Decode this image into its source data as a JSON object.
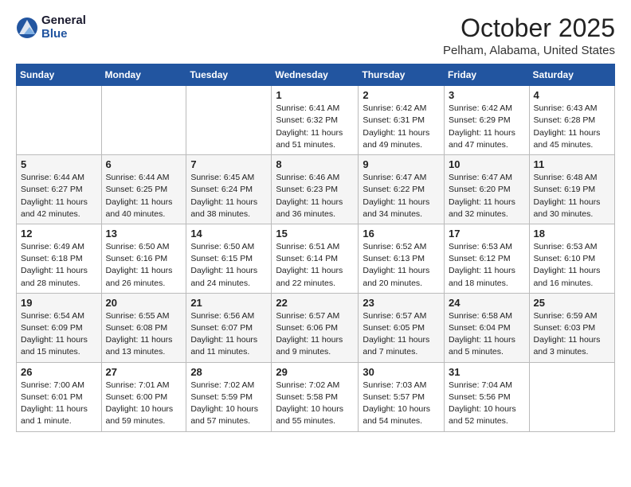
{
  "logo": {
    "general": "General",
    "blue": "Blue"
  },
  "header": {
    "month": "October 2025",
    "location": "Pelham, Alabama, United States"
  },
  "weekdays": [
    "Sunday",
    "Monday",
    "Tuesday",
    "Wednesday",
    "Thursday",
    "Friday",
    "Saturday"
  ],
  "weeks": [
    [
      {
        "day": "",
        "info": ""
      },
      {
        "day": "",
        "info": ""
      },
      {
        "day": "",
        "info": ""
      },
      {
        "day": "1",
        "info": "Sunrise: 6:41 AM\nSunset: 6:32 PM\nDaylight: 11 hours\nand 51 minutes."
      },
      {
        "day": "2",
        "info": "Sunrise: 6:42 AM\nSunset: 6:31 PM\nDaylight: 11 hours\nand 49 minutes."
      },
      {
        "day": "3",
        "info": "Sunrise: 6:42 AM\nSunset: 6:29 PM\nDaylight: 11 hours\nand 47 minutes."
      },
      {
        "day": "4",
        "info": "Sunrise: 6:43 AM\nSunset: 6:28 PM\nDaylight: 11 hours\nand 45 minutes."
      }
    ],
    [
      {
        "day": "5",
        "info": "Sunrise: 6:44 AM\nSunset: 6:27 PM\nDaylight: 11 hours\nand 42 minutes."
      },
      {
        "day": "6",
        "info": "Sunrise: 6:44 AM\nSunset: 6:25 PM\nDaylight: 11 hours\nand 40 minutes."
      },
      {
        "day": "7",
        "info": "Sunrise: 6:45 AM\nSunset: 6:24 PM\nDaylight: 11 hours\nand 38 minutes."
      },
      {
        "day": "8",
        "info": "Sunrise: 6:46 AM\nSunset: 6:23 PM\nDaylight: 11 hours\nand 36 minutes."
      },
      {
        "day": "9",
        "info": "Sunrise: 6:47 AM\nSunset: 6:22 PM\nDaylight: 11 hours\nand 34 minutes."
      },
      {
        "day": "10",
        "info": "Sunrise: 6:47 AM\nSunset: 6:20 PM\nDaylight: 11 hours\nand 32 minutes."
      },
      {
        "day": "11",
        "info": "Sunrise: 6:48 AM\nSunset: 6:19 PM\nDaylight: 11 hours\nand 30 minutes."
      }
    ],
    [
      {
        "day": "12",
        "info": "Sunrise: 6:49 AM\nSunset: 6:18 PM\nDaylight: 11 hours\nand 28 minutes."
      },
      {
        "day": "13",
        "info": "Sunrise: 6:50 AM\nSunset: 6:16 PM\nDaylight: 11 hours\nand 26 minutes."
      },
      {
        "day": "14",
        "info": "Sunrise: 6:50 AM\nSunset: 6:15 PM\nDaylight: 11 hours\nand 24 minutes."
      },
      {
        "day": "15",
        "info": "Sunrise: 6:51 AM\nSunset: 6:14 PM\nDaylight: 11 hours\nand 22 minutes."
      },
      {
        "day": "16",
        "info": "Sunrise: 6:52 AM\nSunset: 6:13 PM\nDaylight: 11 hours\nand 20 minutes."
      },
      {
        "day": "17",
        "info": "Sunrise: 6:53 AM\nSunset: 6:12 PM\nDaylight: 11 hours\nand 18 minutes."
      },
      {
        "day": "18",
        "info": "Sunrise: 6:53 AM\nSunset: 6:10 PM\nDaylight: 11 hours\nand 16 minutes."
      }
    ],
    [
      {
        "day": "19",
        "info": "Sunrise: 6:54 AM\nSunset: 6:09 PM\nDaylight: 11 hours\nand 15 minutes."
      },
      {
        "day": "20",
        "info": "Sunrise: 6:55 AM\nSunset: 6:08 PM\nDaylight: 11 hours\nand 13 minutes."
      },
      {
        "day": "21",
        "info": "Sunrise: 6:56 AM\nSunset: 6:07 PM\nDaylight: 11 hours\nand 11 minutes."
      },
      {
        "day": "22",
        "info": "Sunrise: 6:57 AM\nSunset: 6:06 PM\nDaylight: 11 hours\nand 9 minutes."
      },
      {
        "day": "23",
        "info": "Sunrise: 6:57 AM\nSunset: 6:05 PM\nDaylight: 11 hours\nand 7 minutes."
      },
      {
        "day": "24",
        "info": "Sunrise: 6:58 AM\nSunset: 6:04 PM\nDaylight: 11 hours\nand 5 minutes."
      },
      {
        "day": "25",
        "info": "Sunrise: 6:59 AM\nSunset: 6:03 PM\nDaylight: 11 hours\nand 3 minutes."
      }
    ],
    [
      {
        "day": "26",
        "info": "Sunrise: 7:00 AM\nSunset: 6:01 PM\nDaylight: 11 hours\nand 1 minute."
      },
      {
        "day": "27",
        "info": "Sunrise: 7:01 AM\nSunset: 6:00 PM\nDaylight: 10 hours\nand 59 minutes."
      },
      {
        "day": "28",
        "info": "Sunrise: 7:02 AM\nSunset: 5:59 PM\nDaylight: 10 hours\nand 57 minutes."
      },
      {
        "day": "29",
        "info": "Sunrise: 7:02 AM\nSunset: 5:58 PM\nDaylight: 10 hours\nand 55 minutes."
      },
      {
        "day": "30",
        "info": "Sunrise: 7:03 AM\nSunset: 5:57 PM\nDaylight: 10 hours\nand 54 minutes."
      },
      {
        "day": "31",
        "info": "Sunrise: 7:04 AM\nSunset: 5:56 PM\nDaylight: 10 hours\nand 52 minutes."
      },
      {
        "day": "",
        "info": ""
      }
    ]
  ]
}
